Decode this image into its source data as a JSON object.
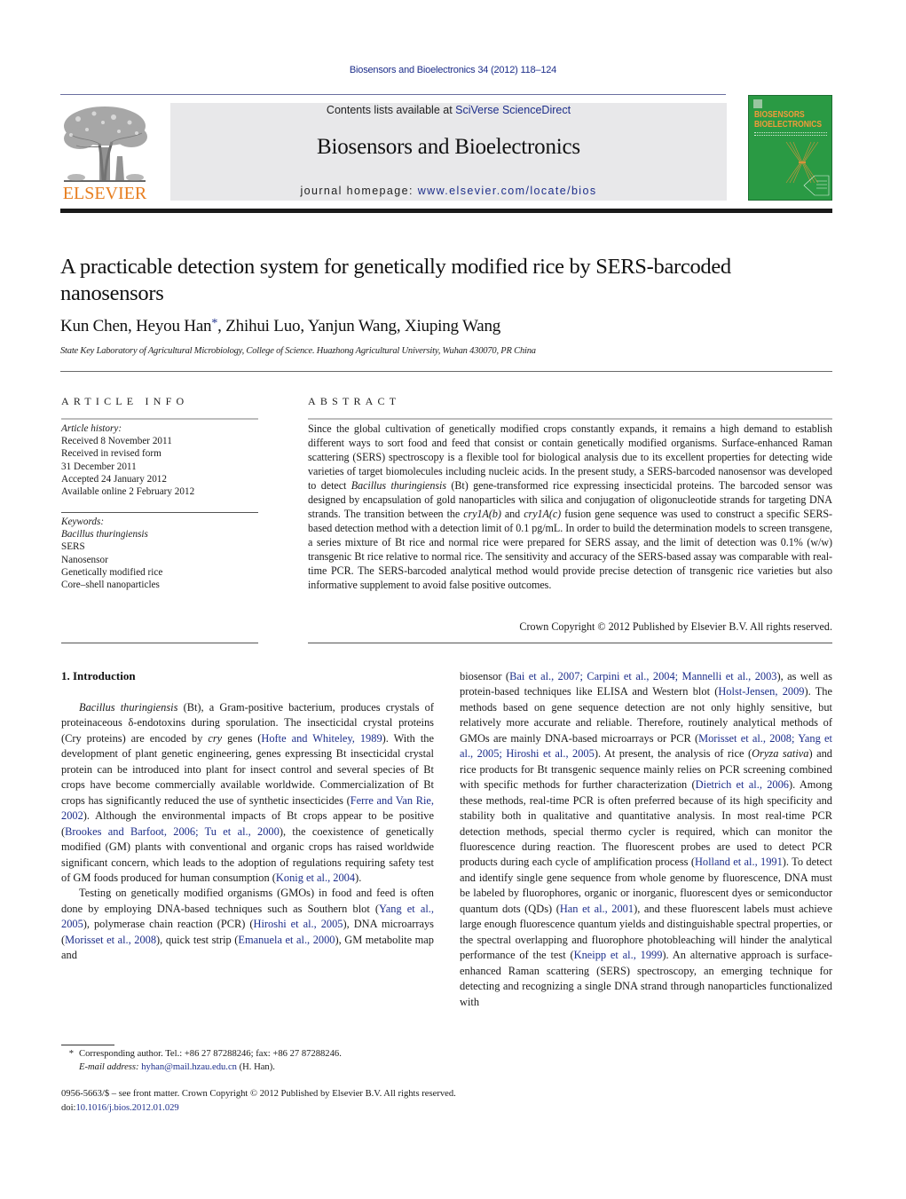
{
  "running_head": "Biosensors and Bioelectronics 34 (2012) 118–124",
  "masthead": {
    "publisher_logo_text": "ELSEVIER",
    "contents_prefix": "Contents lists available at ",
    "contents_link": "SciVerse ScienceDirect",
    "journal_name": "Biosensors and Bioelectronics",
    "homepage_prefix": "journal homepage: ",
    "homepage_link": "www.elsevier.com/locate/bios",
    "cover_title_line1": "BIOSENSORS",
    "cover_title_line2": "BIOELECTRONICS",
    "colors": {
      "brand_orange": "#e77d1e",
      "link_blue": "#1d2e8a",
      "cover_green": "#2a9a44"
    }
  },
  "article": {
    "title": "A practicable detection system for genetically modified rice by SERS-barcoded nanosensors",
    "authors": [
      {
        "name": "Kun Chen",
        "corresponding": false
      },
      {
        "name": "Heyou Han",
        "corresponding": true
      },
      {
        "name": "Zhihui Luo",
        "corresponding": false
      },
      {
        "name": "Yanjun Wang",
        "corresponding": false
      },
      {
        "name": "Xiuping Wang",
        "corresponding": false
      }
    ],
    "corresponding_marker": "*",
    "affiliation": "State Key Laboratory of Agricultural Microbiology, College of Science. Huazhong Agricultural University, Wuhan 430070, PR China"
  },
  "article_info": {
    "heading": "ARTICLE INFO",
    "history_label": "Article history:",
    "history": [
      "Received 8 November 2011",
      "Received in revised form",
      "31 December 2011",
      "Accepted 24 January 2012",
      "Available online 2 February 2012"
    ],
    "keywords_label": "Keywords:",
    "keywords": [
      {
        "text": "Bacillus thuringiensis",
        "italic": true
      },
      {
        "text": "SERS",
        "italic": false
      },
      {
        "text": "Nanosensor",
        "italic": false
      },
      {
        "text": "Genetically modified rice",
        "italic": false
      },
      {
        "text": "Core–shell nanoparticles",
        "italic": false
      }
    ]
  },
  "abstract": {
    "heading": "ABSTRACT",
    "segments": [
      {
        "t": "Since the global cultivation of genetically modified crops constantly expands, it remains a high demand to establish different ways to sort food and feed that consist or contain genetically modified organisms. Surface-enhanced Raman scattering (SERS) spectroscopy is a flexible tool for biological analysis due to its excellent properties for detecting wide varieties of target biomolecules including nucleic acids. In the present study, a SERS-barcoded nanosensor was developed to detect "
      },
      {
        "t": "Bacillus thuringiensis",
        "i": true
      },
      {
        "t": " (Bt) gene-transformed rice expressing insecticidal proteins. The barcoded sensor was designed by encapsulation of gold nanoparticles with silica and conjugation of oligonucleotide strands for targeting DNA strands. The transition between the "
      },
      {
        "t": "cry1A(b)",
        "i": true
      },
      {
        "t": " and "
      },
      {
        "t": "cry1A(c)",
        "i": true
      },
      {
        "t": " fusion gene sequence was used to construct a specific SERS-based detection method with a detection limit of 0.1 pg/mL. In order to build the determination models to screen transgene, a series mixture of Bt rice and normal rice were prepared for SERS assay, and the limit of detection was 0.1% (w/w) transgenic Bt rice relative to normal rice. The sensitivity and accuracy of the SERS-based assay was comparable with real-time PCR. The SERS-barcoded analytical method would provide precise detection of transgenic rice varieties but also informative supplement to avoid false positive outcomes."
      }
    ],
    "copyright": "Crown Copyright © 2012 Published by Elsevier B.V. All rights reserved."
  },
  "body": {
    "section_heading": "1.  Introduction",
    "left_paragraphs": [
      [
        {
          "t": "Bacillus thuringiensis",
          "i": true
        },
        {
          "t": " (Bt), a Gram-positive bacterium, produces crystals of proteinaceous δ-endotoxins during sporulation. The insecticidal crystal proteins (Cry proteins) are encoded by "
        },
        {
          "t": "cry",
          "i": true
        },
        {
          "t": " genes ("
        },
        {
          "t": "Hofte and Whiteley, 1989",
          "link": true
        },
        {
          "t": "). With the development of plant genetic engineering, genes expressing Bt insecticidal crystal protein can be introduced into plant for insect control and several species of Bt crops have become commercially available worldwide. Commer­cialization of Bt crops has significantly reduced the use of synthetic insecticides ("
        },
        {
          "t": "Ferre and Van Rie, 2002",
          "link": true
        },
        {
          "t": "). Although the environmen­tal impacts of Bt crops appear to be positive ("
        },
        {
          "t": "Brookes and Barfoot, 2006; Tu et al., 2000",
          "link": true
        },
        {
          "t": "), the coexistence of genetically modified (GM) plants with conventional and organic crops has raised worldwide significant concern, which leads to the adoption of regulations requiring safety test of GM foods produced for human consumption ("
        },
        {
          "t": "Konig et al., 2004",
          "link": true
        },
        {
          "t": ")."
        }
      ],
      [
        {
          "t": "Testing on genetically modified organisms (GMOs) in food and feed is often done by employing DNA-based techniques such as Southern blot ("
        },
        {
          "t": "Yang et al., 2005",
          "link": true
        },
        {
          "t": "), polymerase chain reaction (PCR) ("
        },
        {
          "t": "Hiroshi et al., 2005",
          "link": true
        },
        {
          "t": "), DNA microarrays ("
        },
        {
          "t": "Morisset et al., 2008",
          "link": true
        },
        {
          "t": "), quick test strip ("
        },
        {
          "t": "Emanuela et al., 2000",
          "link": true
        },
        {
          "t": "), GM metabolite map and"
        }
      ]
    ],
    "right_paragraph": [
      {
        "t": "biosensor ("
      },
      {
        "t": "Bai et al., 2007; Carpini et al., 2004; Mannelli et al., 2003",
        "link": true
      },
      {
        "t": "), as well as protein-based techniques like ELISA and Western blot ("
      },
      {
        "t": "Holst-Jensen, 2009",
        "link": true
      },
      {
        "t": "). The methods based on gene sequence detection are not only highly sensitive, but relatively more accu­rate and reliable. Therefore, routinely analytical methods of GMOs are mainly DNA-based microarrays or PCR ("
      },
      {
        "t": "Morisset et al., 2008; Yang et al., 2005; Hiroshi et al., 2005",
        "link": true
      },
      {
        "t": "). At present, the analysis of rice ("
      },
      {
        "t": "Oryza sativa",
        "i": true
      },
      {
        "t": ") and rice products for Bt transgenic sequence mainly relies on PCR screening combined with specific methods for further characterization ("
      },
      {
        "t": "Dietrich et al., 2006",
        "link": true
      },
      {
        "t": "). Among these methods, real-time PCR is often preferred because of its high speci­ficity and stability both in qualitative and quantitative analysis. In most real-time PCR detection methods, special thermo cycler is required, which can monitor the fluorescence during reaction. The fluorescent probes are used to detect PCR products during each cycle of amplification process ("
      },
      {
        "t": "Holland et al., 1991",
        "link": true
      },
      {
        "t": "). To detect and identify single gene sequence from whole genome by fluorescence, DNA must be labeled by fluorophores, organic or inorganic, fluores­cent dyes or semiconductor quantum dots (QDs) ("
      },
      {
        "t": "Han et al., 2001",
        "link": true
      },
      {
        "t": "), and these fluorescent labels must achieve large enough fluores­cence quantum yields and distinguishable spectral properties, or the spectral overlapping and fluorophore photobleaching will hin­der the analytical performance of the test ("
      },
      {
        "t": "Kneipp et al., 1999",
        "link": true
      },
      {
        "t": "). An alternative approach is surface-enhanced Raman scattering (SERS) spectroscopy, an emerging technique for detecting and recogniz­ing a single DNA strand through nanoparticles functionalized with"
      }
    ]
  },
  "footnote": {
    "marker": "*",
    "line1": "Corresponding author. Tel.: +86 27 87288246; fax: +86 27 87288246.",
    "email_label": "E-mail address:",
    "email": "hyhan@mail.hzau.edu.cn",
    "email_suffix": " (H. Han)."
  },
  "front_matter": {
    "issn_line": "0956-5663/$ – see front matter. Crown Copyright © 2012 Published by Elsevier B.V. All rights reserved.",
    "doi_prefix": "doi:",
    "doi": "10.1016/j.bios.2012.01.029"
  }
}
